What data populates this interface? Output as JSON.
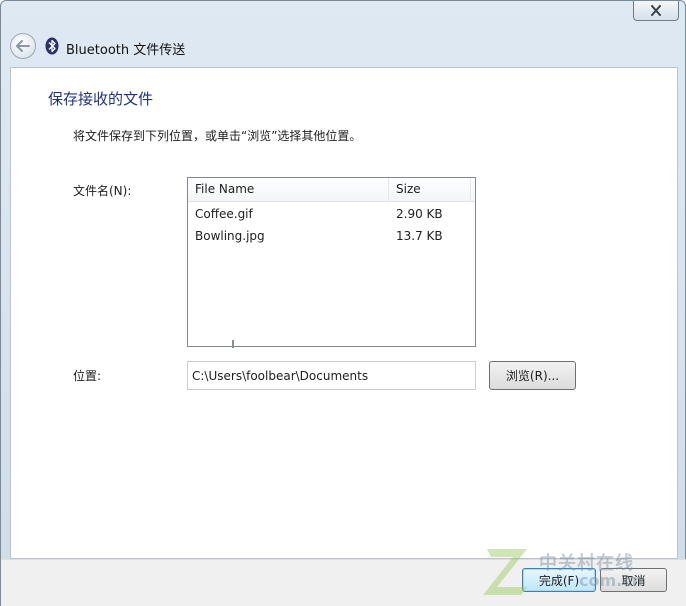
{
  "window": {
    "title": "Bluetooth 文件传送",
    "close_label": "✕"
  },
  "page": {
    "heading": "保存接收的文件",
    "instruction": "将文件保存到下列位置，或单击“浏览”选择其他位置。"
  },
  "files": {
    "label": "文件名(N):",
    "columns": {
      "name": "File Name",
      "size": "Size"
    },
    "rows": [
      {
        "name": "Coffee.gif",
        "size": "2.90 KB"
      },
      {
        "name": "Bowling.jpg",
        "size": "13.7 KB"
      }
    ]
  },
  "location": {
    "label": "位置:",
    "value": "C:\\Users\\foolbear\\Documents",
    "browse_label": "浏览(R)..."
  },
  "footer": {
    "finish_label": "完成(F)",
    "cancel_label": "取消"
  },
  "watermark": {
    "top": "中关村在线",
    "bottom": "com.cn"
  },
  "colors": {
    "heading": "#1e3287",
    "frame": "#cfdde9"
  }
}
